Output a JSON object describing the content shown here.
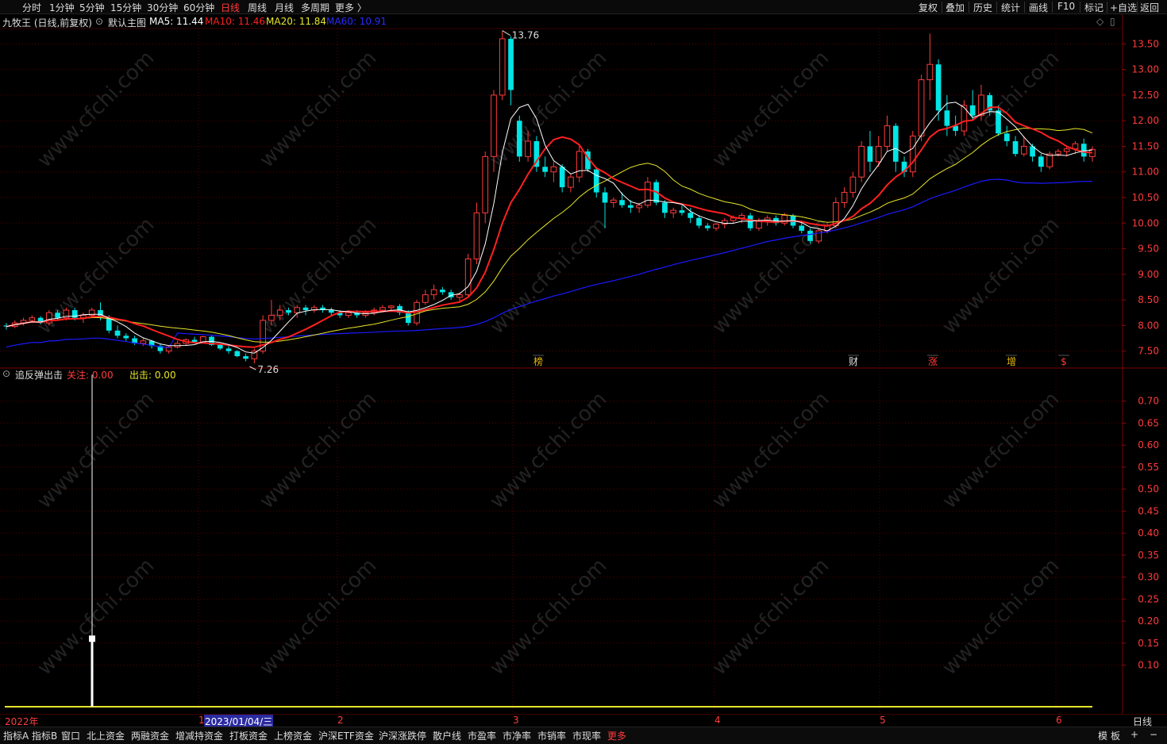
{
  "toolbar": {
    "periods": [
      "分时",
      "1分钟",
      "5分钟",
      "15分钟",
      "30分钟",
      "60分钟",
      "日线",
      "周线",
      "月线",
      "多周期",
      "更多 〉"
    ],
    "active_period": "日线",
    "tools": [
      "复权",
      "叠加",
      "历史",
      "统计",
      "画线",
      "F10",
      "标记",
      "+自选",
      "返回"
    ]
  },
  "main_header": {
    "stock_title": "九牧王 (日线,前复权)",
    "chart_name": "默认主图",
    "ma5_label": "MA5: 11.44",
    "ma10_label": "MA10: 11.46",
    "ma20_label": "MA20: 11.84",
    "ma60_label": "MA60: 10.91"
  },
  "indicator_header": {
    "name": "追反弹出击",
    "focus_label": "关注: 0.00",
    "out_label": "出击: 0.00"
  },
  "price_axis": {
    "ticks": [
      "13.50",
      "13.00",
      "12.50",
      "12.00",
      "11.50",
      "11.00",
      "10.50",
      "10.00",
      "9.50",
      "9.00",
      "8.50",
      "8.00",
      "7.50"
    ]
  },
  "indicator_axis": {
    "ticks": [
      "0.70",
      "0.65",
      "0.60",
      "0.55",
      "0.50",
      "0.45",
      "0.40",
      "0.35",
      "0.30",
      "0.25",
      "0.20",
      "0.15",
      "0.10"
    ]
  },
  "annotations": {
    "high_price": "13.76",
    "low_price": "7.26"
  },
  "event_markers": [
    "榜",
    "财",
    "涨",
    "增",
    "$"
  ],
  "date_axis": {
    "labels": [
      "2022年",
      "1",
      "2023/01/04/三",
      "2",
      "3",
      "4",
      "5",
      "6"
    ],
    "period_label": "日线"
  },
  "bottom_tabs": [
    "指标A",
    "指标B",
    "窗口",
    "北上资金",
    "两融资金",
    "增减持资金",
    "打板资金",
    "上榜资金",
    "沪深ETF资金",
    "沪深涨跌停",
    "散户线",
    "市盈率",
    "市净率",
    "市销率",
    "市现率",
    "更多"
  ],
  "bottom_right": [
    "模",
    "板",
    "+",
    "−"
  ],
  "watermark": "www.cfchi.com",
  "colors": {
    "up": "#ff3b3b",
    "down": "#00e5e5",
    "ma5": "#ffffff",
    "ma10": "#ff2020",
    "ma20": "#e6e62a",
    "ma60": "#1a1aff",
    "grid": "#5a0000"
  },
  "chart_data": {
    "type": "candlestick",
    "ylim": [
      7.2,
      13.8
    ],
    "candles": [
      [
        8.0,
        8.05,
        7.92,
        7.98
      ],
      [
        7.98,
        8.1,
        7.95,
        8.05
      ],
      [
        8.05,
        8.15,
        8.0,
        8.1
      ],
      [
        8.1,
        8.2,
        8.05,
        8.15
      ],
      [
        8.15,
        8.18,
        8.02,
        8.05
      ],
      [
        8.05,
        8.3,
        8.0,
        8.25
      ],
      [
        8.25,
        8.3,
        8.1,
        8.15
      ],
      [
        8.15,
        8.35,
        8.1,
        8.3
      ],
      [
        8.3,
        8.35,
        8.1,
        8.15
      ],
      [
        8.15,
        8.25,
        8.05,
        8.2
      ],
      [
        8.2,
        8.35,
        8.15,
        8.3
      ],
      [
        8.3,
        8.45,
        8.1,
        8.15
      ],
      [
        8.15,
        8.2,
        7.85,
        7.9
      ],
      [
        7.9,
        8.0,
        7.75,
        7.8
      ],
      [
        7.8,
        7.85,
        7.7,
        7.75
      ],
      [
        7.75,
        7.8,
        7.62,
        7.65
      ],
      [
        7.65,
        7.75,
        7.6,
        7.7
      ],
      [
        7.7,
        7.72,
        7.55,
        7.6
      ],
      [
        7.6,
        7.65,
        7.45,
        7.5
      ],
      [
        7.5,
        7.6,
        7.45,
        7.58
      ],
      [
        7.58,
        7.7,
        7.55,
        7.65
      ],
      [
        7.65,
        7.75,
        7.6,
        7.72
      ],
      [
        7.72,
        7.78,
        7.65,
        7.68
      ],
      [
        7.68,
        7.8,
        7.65,
        7.78
      ],
      [
        7.78,
        7.8,
        7.6,
        7.62
      ],
      [
        7.62,
        7.65,
        7.52,
        7.55
      ],
      [
        7.55,
        7.6,
        7.45,
        7.5
      ],
      [
        7.5,
        7.52,
        7.38,
        7.4
      ],
      [
        7.4,
        7.45,
        7.3,
        7.35
      ],
      [
        7.35,
        7.55,
        7.26,
        7.5
      ],
      [
        7.5,
        8.2,
        7.45,
        8.1
      ],
      [
        8.1,
        8.5,
        8.0,
        8.2
      ],
      [
        8.2,
        8.4,
        8.1,
        8.3
      ],
      [
        8.3,
        8.35,
        8.2,
        8.25
      ],
      [
        8.25,
        8.4,
        8.15,
        8.35
      ],
      [
        8.35,
        8.4,
        8.2,
        8.3
      ],
      [
        8.3,
        8.4,
        8.25,
        8.35
      ],
      [
        8.35,
        8.4,
        8.25,
        8.3
      ],
      [
        8.3,
        8.35,
        8.2,
        8.25
      ],
      [
        8.25,
        8.3,
        8.15,
        8.2
      ],
      [
        8.2,
        8.3,
        8.15,
        8.25
      ],
      [
        8.25,
        8.3,
        8.15,
        8.2
      ],
      [
        8.2,
        8.3,
        8.15,
        8.25
      ],
      [
        8.25,
        8.35,
        8.2,
        8.3
      ],
      [
        8.3,
        8.4,
        8.25,
        8.35
      ],
      [
        8.35,
        8.4,
        8.3,
        8.38
      ],
      [
        8.38,
        8.42,
        8.2,
        8.25
      ],
      [
        8.25,
        8.3,
        8.0,
        8.05
      ],
      [
        8.05,
        8.5,
        8.0,
        8.45
      ],
      [
        8.45,
        8.7,
        8.4,
        8.6
      ],
      [
        8.6,
        8.8,
        8.5,
        8.7
      ],
      [
        8.7,
        8.75,
        8.6,
        8.65
      ],
      [
        8.65,
        8.7,
        8.5,
        8.55
      ],
      [
        8.55,
        8.65,
        8.45,
        8.6
      ],
      [
        8.6,
        9.4,
        8.55,
        9.3
      ],
      [
        9.3,
        10.4,
        9.2,
        10.2
      ],
      [
        10.2,
        11.4,
        10.0,
        11.3
      ],
      [
        11.3,
        12.6,
        11.0,
        12.5
      ],
      [
        12.5,
        13.76,
        12.4,
        13.6
      ],
      [
        13.6,
        13.65,
        12.3,
        12.6
      ],
      [
        12.0,
        12.1,
        11.2,
        11.3
      ],
      [
        11.3,
        11.8,
        11.2,
        11.6
      ],
      [
        11.6,
        11.7,
        11.0,
        11.1
      ],
      [
        11.1,
        11.3,
        10.9,
        11.0
      ],
      [
        11.0,
        11.2,
        10.8,
        11.1
      ],
      [
        11.1,
        11.15,
        10.6,
        10.7
      ],
      [
        10.7,
        10.95,
        10.6,
        10.9
      ],
      [
        10.9,
        11.5,
        10.8,
        11.4
      ],
      [
        11.4,
        11.45,
        11.0,
        11.05
      ],
      [
        11.05,
        11.1,
        10.5,
        10.6
      ],
      [
        10.6,
        10.7,
        9.9,
        10.4
      ],
      [
        10.4,
        10.5,
        10.3,
        10.45
      ],
      [
        10.45,
        10.6,
        10.3,
        10.35
      ],
      [
        10.35,
        10.45,
        10.2,
        10.3
      ],
      [
        10.3,
        10.4,
        10.2,
        10.35
      ],
      [
        10.35,
        10.9,
        10.3,
        10.8
      ],
      [
        10.8,
        10.85,
        10.35,
        10.4
      ],
      [
        10.4,
        10.45,
        10.1,
        10.2
      ],
      [
        10.2,
        10.3,
        10.1,
        10.25
      ],
      [
        10.25,
        10.35,
        10.15,
        10.2
      ],
      [
        10.2,
        10.3,
        10.0,
        10.1
      ],
      [
        10.1,
        10.15,
        9.9,
        9.95
      ],
      [
        9.95,
        10.0,
        9.85,
        9.9
      ],
      [
        9.9,
        10.0,
        9.85,
        9.98
      ],
      [
        9.98,
        10.1,
        9.9,
        10.05
      ],
      [
        10.05,
        10.15,
        10.0,
        10.1
      ],
      [
        10.1,
        10.2,
        10.0,
        10.15
      ],
      [
        10.15,
        10.2,
        9.85,
        9.9
      ],
      [
        9.9,
        10.1,
        9.85,
        10.05
      ],
      [
        10.05,
        10.15,
        9.95,
        10.1
      ],
      [
        10.1,
        10.15,
        9.95,
        10.0
      ],
      [
        10.0,
        10.2,
        9.95,
        10.15
      ],
      [
        10.15,
        10.18,
        9.9,
        9.95
      ],
      [
        9.95,
        10.0,
        9.8,
        9.85
      ],
      [
        9.85,
        9.9,
        9.6,
        9.65
      ],
      [
        9.65,
        9.9,
        9.6,
        9.85
      ],
      [
        9.85,
        10.0,
        9.8,
        9.95
      ],
      [
        9.95,
        10.5,
        9.9,
        10.4
      ],
      [
        10.4,
        10.7,
        10.3,
        10.6
      ],
      [
        10.6,
        11.0,
        10.5,
        10.9
      ],
      [
        10.9,
        11.6,
        10.8,
        11.5
      ],
      [
        11.5,
        11.8,
        11.0,
        11.2
      ],
      [
        11.2,
        11.7,
        11.1,
        11.5
      ],
      [
        11.5,
        12.1,
        11.4,
        11.9
      ],
      [
        11.9,
        11.95,
        11.0,
        11.2
      ],
      [
        11.2,
        11.3,
        10.9,
        11.0
      ],
      [
        11.0,
        11.8,
        10.9,
        11.7
      ],
      [
        11.7,
        12.9,
        11.6,
        12.8
      ],
      [
        12.8,
        13.7,
        12.4,
        13.1
      ],
      [
        13.1,
        13.2,
        12.0,
        12.2
      ],
      [
        12.2,
        12.5,
        11.7,
        11.9
      ],
      [
        11.9,
        12.1,
        11.7,
        11.8
      ],
      [
        11.8,
        12.4,
        11.7,
        12.3
      ],
      [
        12.3,
        12.6,
        12.0,
        12.1
      ],
      [
        12.1,
        12.7,
        12.0,
        12.5
      ],
      [
        12.5,
        12.55,
        12.1,
        12.2
      ],
      [
        12.2,
        12.3,
        11.7,
        11.75
      ],
      [
        11.75,
        11.9,
        11.5,
        11.6
      ],
      [
        11.6,
        11.7,
        11.3,
        11.35
      ],
      [
        11.35,
        11.7,
        11.3,
        11.5
      ],
      [
        11.5,
        11.55,
        11.2,
        11.3
      ],
      [
        11.3,
        11.35,
        11.0,
        11.1
      ],
      [
        11.1,
        11.4,
        11.05,
        11.35
      ],
      [
        11.35,
        11.45,
        11.3,
        11.4
      ],
      [
        11.4,
        11.5,
        11.3,
        11.45
      ],
      [
        11.45,
        11.6,
        11.35,
        11.55
      ],
      [
        11.55,
        11.65,
        11.2,
        11.3
      ],
      [
        11.3,
        11.5,
        11.2,
        11.44
      ]
    ],
    "indicator_ylim": [
      0.0,
      0.75
    ],
    "indicator_spike_index": 11,
    "indicator_spike_value": 0.76,
    "indicator_spike_marker": 0.16
  }
}
